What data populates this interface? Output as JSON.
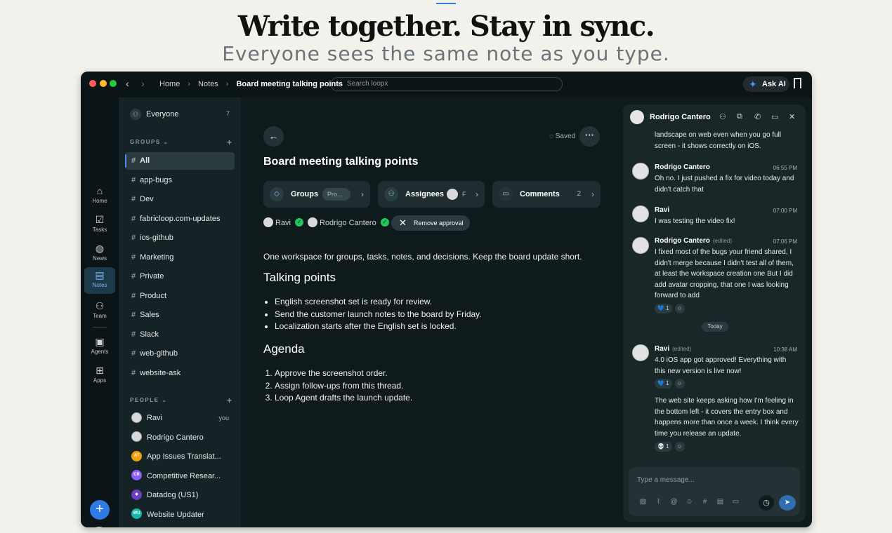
{
  "hero": {
    "title": "Write together. Stay in sync.",
    "subtitle": "Everyone sees the same note as you type."
  },
  "titlebar": {
    "breadcrumbs": [
      "Home",
      "Notes",
      "Board meeting talking points"
    ],
    "search_placeholder": "Search loopx",
    "ask_ai": "Ask AI"
  },
  "rail": {
    "items": [
      {
        "label": "Home",
        "icon": "home-icon"
      },
      {
        "label": "Tasks",
        "icon": "tasks-icon"
      },
      {
        "label": "News",
        "icon": "globe-icon"
      },
      {
        "label": "Notes",
        "icon": "notes-icon",
        "active": true
      },
      {
        "label": "Team",
        "icon": "team-icon"
      },
      {
        "label": "Agents",
        "icon": "robot-icon"
      },
      {
        "label": "Apps",
        "icon": "apps-icon"
      }
    ]
  },
  "sidebar": {
    "everyone": {
      "label": "Everyone",
      "count": "7"
    },
    "groups_title": "GROUPS",
    "groups": [
      "All",
      "app-bugs",
      "Dev",
      "fabricloop.com-updates",
      "ios-github",
      "Marketing",
      "Private",
      "Product",
      "Sales",
      "Slack",
      "web-github",
      "website-ask"
    ],
    "people_title": "PEOPLE",
    "people": [
      {
        "name": "Ravi",
        "tag": "you",
        "avatar": "photo"
      },
      {
        "name": "Rodrigo Cantero",
        "tag": "",
        "avatar": "photo"
      },
      {
        "name": "App Issues Translat...",
        "tag": "",
        "avatar": "AT"
      },
      {
        "name": "Competitive Resear...",
        "tag": "",
        "avatar": "CR"
      },
      {
        "name": "Datadog (US1)",
        "tag": "",
        "avatar": "datadog"
      },
      {
        "name": "Website Updater",
        "tag": "",
        "avatar": "WU"
      }
    ]
  },
  "note": {
    "saved_label": "Saved",
    "title": "Board meeting talking points",
    "chips": {
      "groups": {
        "label": "Groups",
        "value": "Pro..."
      },
      "assignees": {
        "label": "Assignees",
        "value": "F"
      },
      "comments": {
        "label": "Comments",
        "count": "2"
      }
    },
    "approvers": [
      "Ravi",
      "Rodrigo Cantero"
    ],
    "remove_approval": "Remove approval",
    "intro": "One workspace for groups, tasks, notes, and decisions. Keep the board update short.",
    "talking_points_heading": "Talking points",
    "talking_points": [
      "English screenshot set is ready for review.",
      "Send the customer launch notes to the board by Friday.",
      "Localization starts after the English set is locked."
    ],
    "agenda_heading": "Agenda",
    "agenda": [
      "Approve the screenshot order.",
      "Assign follow-ups from this thread.",
      "Loop Agent drafts the launch update."
    ]
  },
  "chat": {
    "contact": "Rodrigo Cantero",
    "messages": [
      {
        "continuation": true,
        "text": "landscape on web even when you go full screen - it shows correctly on iOS."
      },
      {
        "author": "Rodrigo Cantero",
        "time": "06:55 PM",
        "edited": "",
        "text": "Oh no. I just pushed a fix for video today and didn't catch that"
      },
      {
        "author": "Ravi",
        "time": "07:00 PM",
        "edited": "",
        "text": "I was testing the video fix!"
      },
      {
        "author": "Rodrigo Cantero",
        "time": "07:06 PM",
        "edited": "(edited)",
        "text": "I fixed most of the bugs your friend shared, I didn't merge because I didn't test all of them, at least the workspace creation one But I did add avatar cropping, that one I was looking forward to add",
        "reaction": "💙 1"
      },
      {
        "author": "Ravi",
        "time": "10:38 AM",
        "edited": "(edited)",
        "text": "4.0 iOS app got approved! Everything with this new version is live now!",
        "reaction": "💙 1"
      },
      {
        "continuation": true,
        "text": "The web site keeps asking how I'm feeling in the bottom left - it covers the entry box and happens more than once a week. I think every time you release an update.",
        "reaction": "💀 1"
      }
    ],
    "day_divider": "Today",
    "composer_placeholder": "Type a message..."
  }
}
